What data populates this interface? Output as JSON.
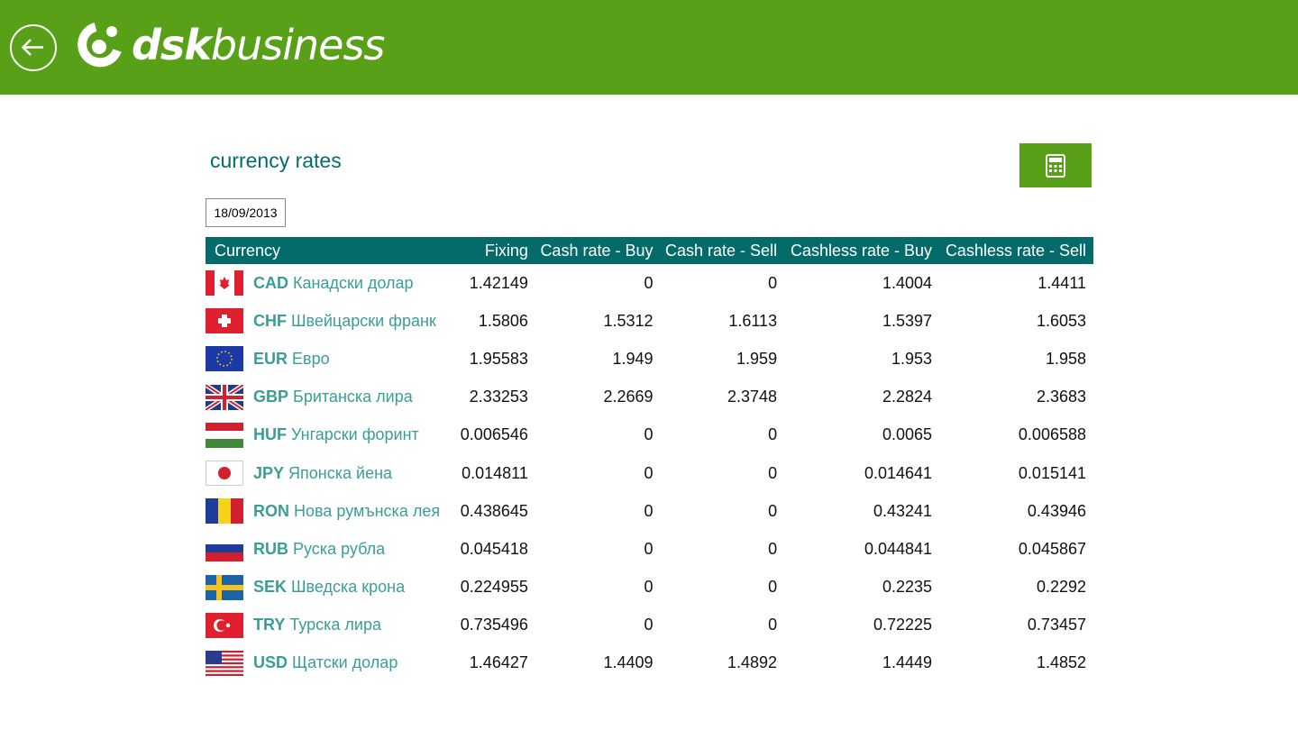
{
  "header": {
    "brand": "dskbusiness",
    "brand_bold": "dsk",
    "brand_light": "business",
    "colors": {
      "bar": "#57a017",
      "accent": "#056b6a",
      "currency_text": "#3a9e96"
    }
  },
  "page": {
    "title": "currency rates",
    "date": "18/09/2013",
    "calculator_icon": "calculator-icon",
    "back_icon": "arrow-left-icon"
  },
  "table": {
    "columns": [
      "Currency",
      "Fixing",
      "Cash rate - Buy",
      "Cash rate - Sell",
      "Cashless rate - Buy",
      "Cashless rate - Sell"
    ],
    "rows": [
      {
        "code": "CAD",
        "name": "Канадски долар",
        "fixing": "1.42149",
        "cash_buy": "0",
        "cash_sell": "0",
        "cashless_buy": "1.4004",
        "cashless_sell": "1.4411"
      },
      {
        "code": "CHF",
        "name": "Швейцарски франк",
        "fixing": "1.5806",
        "cash_buy": "1.5312",
        "cash_sell": "1.6113",
        "cashless_buy": "1.5397",
        "cashless_sell": "1.6053"
      },
      {
        "code": "EUR",
        "name": "Евро",
        "fixing": "1.95583",
        "cash_buy": "1.949",
        "cash_sell": "1.959",
        "cashless_buy": "1.953",
        "cashless_sell": "1.958"
      },
      {
        "code": "GBP",
        "name": "Британска лира",
        "fixing": "2.33253",
        "cash_buy": "2.2669",
        "cash_sell": "2.3748",
        "cashless_buy": "2.2824",
        "cashless_sell": "2.3683"
      },
      {
        "code": "HUF",
        "name": "Унгарски форинт",
        "fixing": "0.006546",
        "cash_buy": "0",
        "cash_sell": "0",
        "cashless_buy": "0.0065",
        "cashless_sell": "0.006588"
      },
      {
        "code": "JPY",
        "name": "Японска йена",
        "fixing": "0.014811",
        "cash_buy": "0",
        "cash_sell": "0",
        "cashless_buy": "0.014641",
        "cashless_sell": "0.015141"
      },
      {
        "code": "RON",
        "name": "Нова румънска лея",
        "fixing": "0.438645",
        "cash_buy": "0",
        "cash_sell": "0",
        "cashless_buy": "0.43241",
        "cashless_sell": "0.43946"
      },
      {
        "code": "RUB",
        "name": "Руска рубла",
        "fixing": "0.045418",
        "cash_buy": "0",
        "cash_sell": "0",
        "cashless_buy": "0.044841",
        "cashless_sell": "0.045867"
      },
      {
        "code": "SEK",
        "name": "Шведска крона",
        "fixing": "0.224955",
        "cash_buy": "0",
        "cash_sell": "0",
        "cashless_buy": "0.2235",
        "cashless_sell": "0.2292"
      },
      {
        "code": "TRY",
        "name": "Турска лира",
        "fixing": "0.735496",
        "cash_buy": "0",
        "cash_sell": "0",
        "cashless_buy": "0.72225",
        "cashless_sell": "0.73457"
      },
      {
        "code": "USD",
        "name": "Щатски долар",
        "fixing": "1.46427",
        "cash_buy": "1.4409",
        "cash_sell": "1.4892",
        "cashless_buy": "1.4449",
        "cashless_sell": "1.4852"
      }
    ]
  }
}
